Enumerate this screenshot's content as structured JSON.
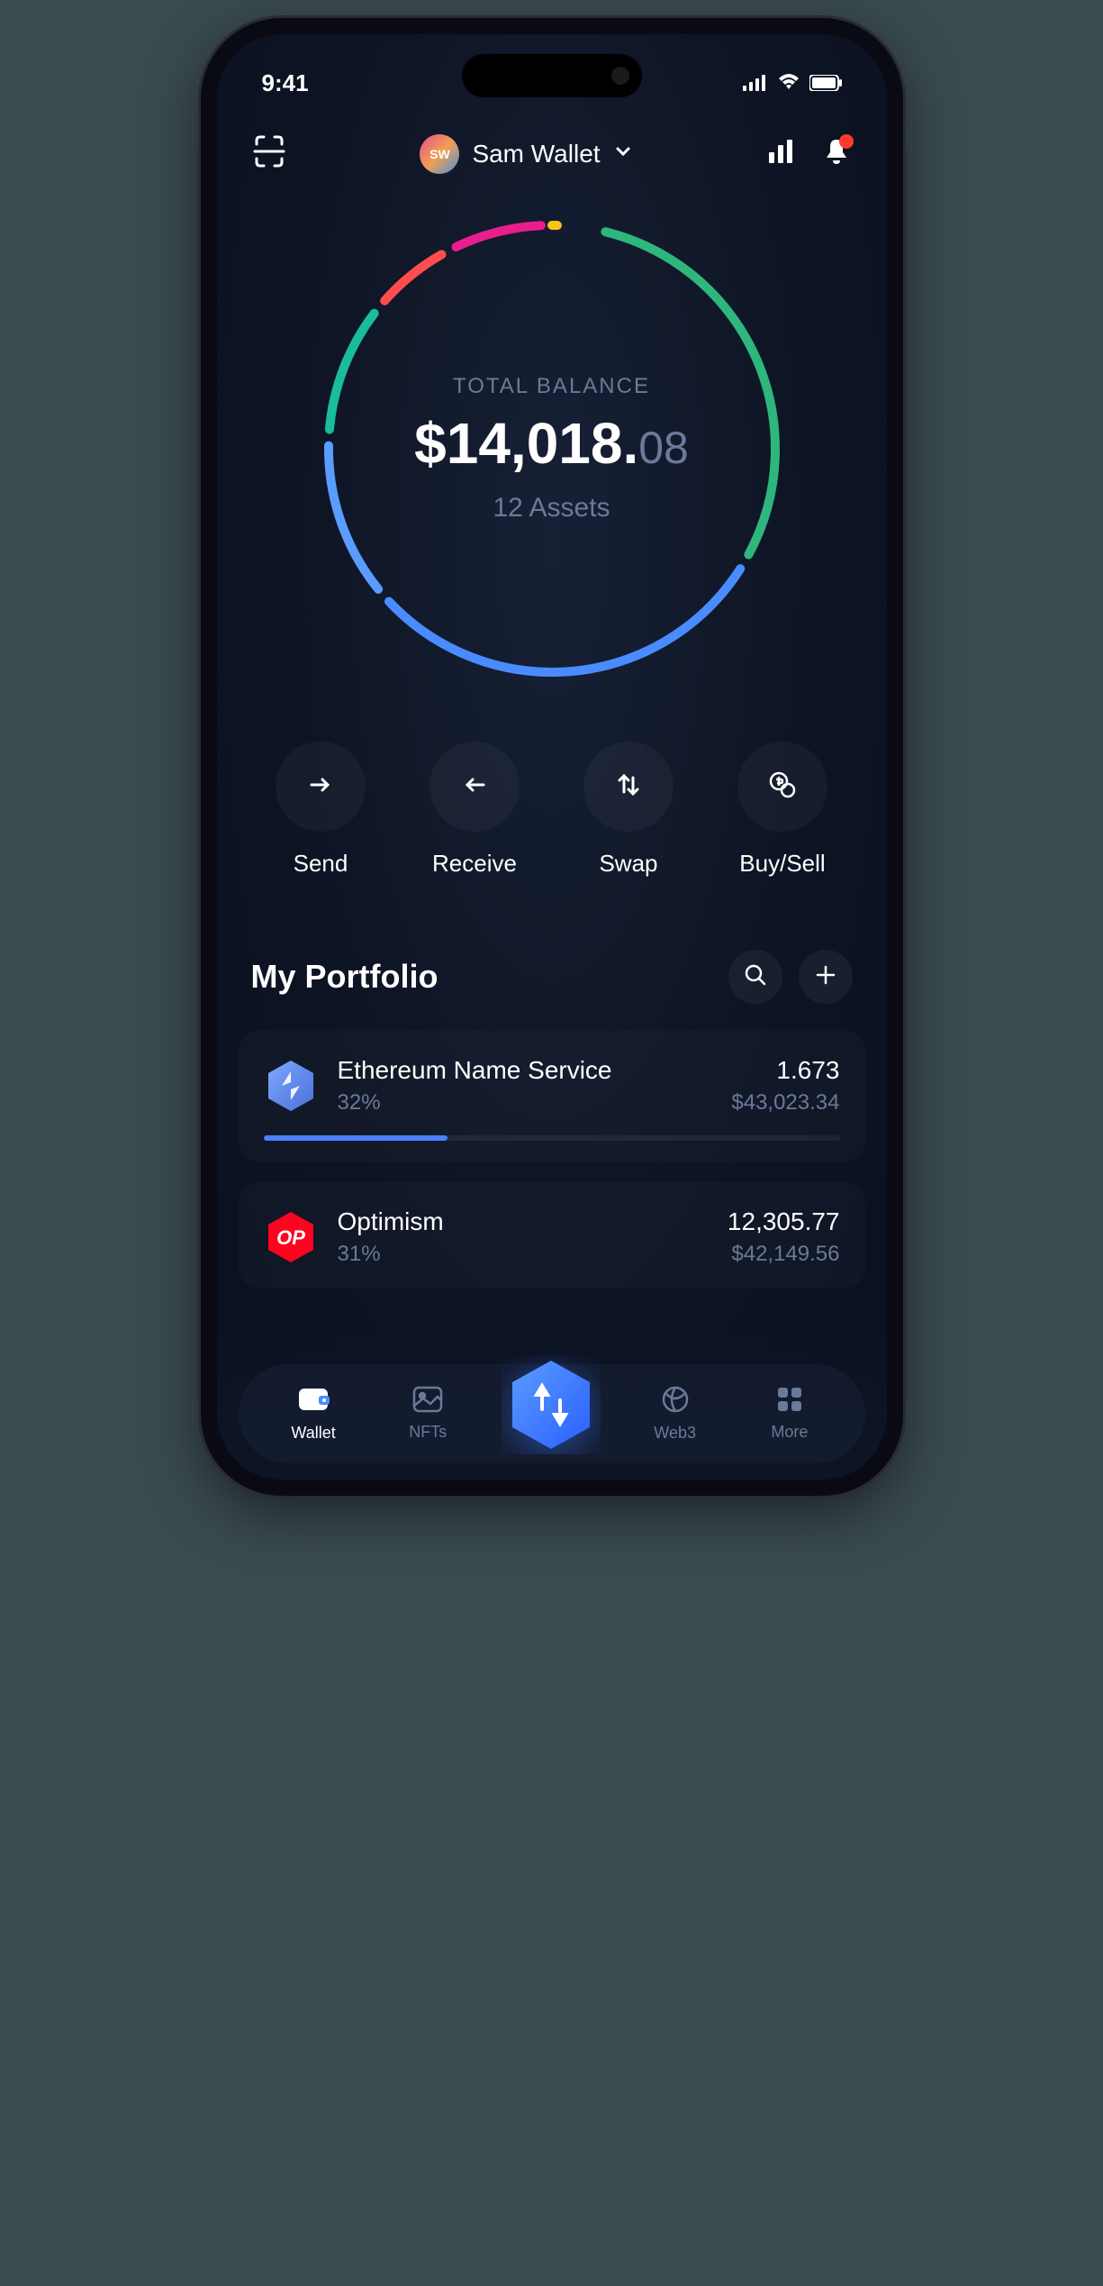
{
  "status": {
    "time": "9:41"
  },
  "header": {
    "wallet_initials": "SW",
    "wallet_name": "Sam Wallet"
  },
  "balance": {
    "label": "TOTAL BALANCE",
    "main": "$14,018.",
    "cents": "08",
    "assets": "12 Assets"
  },
  "chart_data": {
    "type": "pie",
    "title": "Portfolio allocation",
    "series": [
      {
        "name": "Green segment",
        "pct": 30,
        "color": "#2eb67d"
      },
      {
        "name": "Blue segment A",
        "pct": 30,
        "color": "#4a8cff"
      },
      {
        "name": "Blue segment B",
        "pct": 12,
        "color": "#5a9cff"
      },
      {
        "name": "Teal segment",
        "pct": 10,
        "color": "#1abc9c"
      },
      {
        "name": "Red segment",
        "pct": 6,
        "color": "#ff4d4d"
      },
      {
        "name": "Magenta segment",
        "pct": 7,
        "color": "#e91e8c"
      },
      {
        "name": "Yellow segment",
        "pct": 5,
        "color": "#f5c518"
      }
    ]
  },
  "actions": {
    "send": "Send",
    "receive": "Receive",
    "swap": "Swap",
    "buysell": "Buy/Sell"
  },
  "portfolio": {
    "title": "My Portfolio",
    "items": [
      {
        "name": "Ethereum Name Service",
        "pct": "32%",
        "amount": "1.673",
        "usd": "$43,023.34",
        "progress": 32,
        "color": "#5b8def",
        "symbol": "ENS"
      },
      {
        "name": "Optimism",
        "pct": "31%",
        "amount": "12,305.77",
        "usd": "$42,149.56",
        "progress": 31,
        "color": "#ff0420",
        "symbol": "OP"
      }
    ]
  },
  "tabs": {
    "wallet": "Wallet",
    "nfts": "NFTs",
    "web3": "Web3",
    "more": "More"
  }
}
